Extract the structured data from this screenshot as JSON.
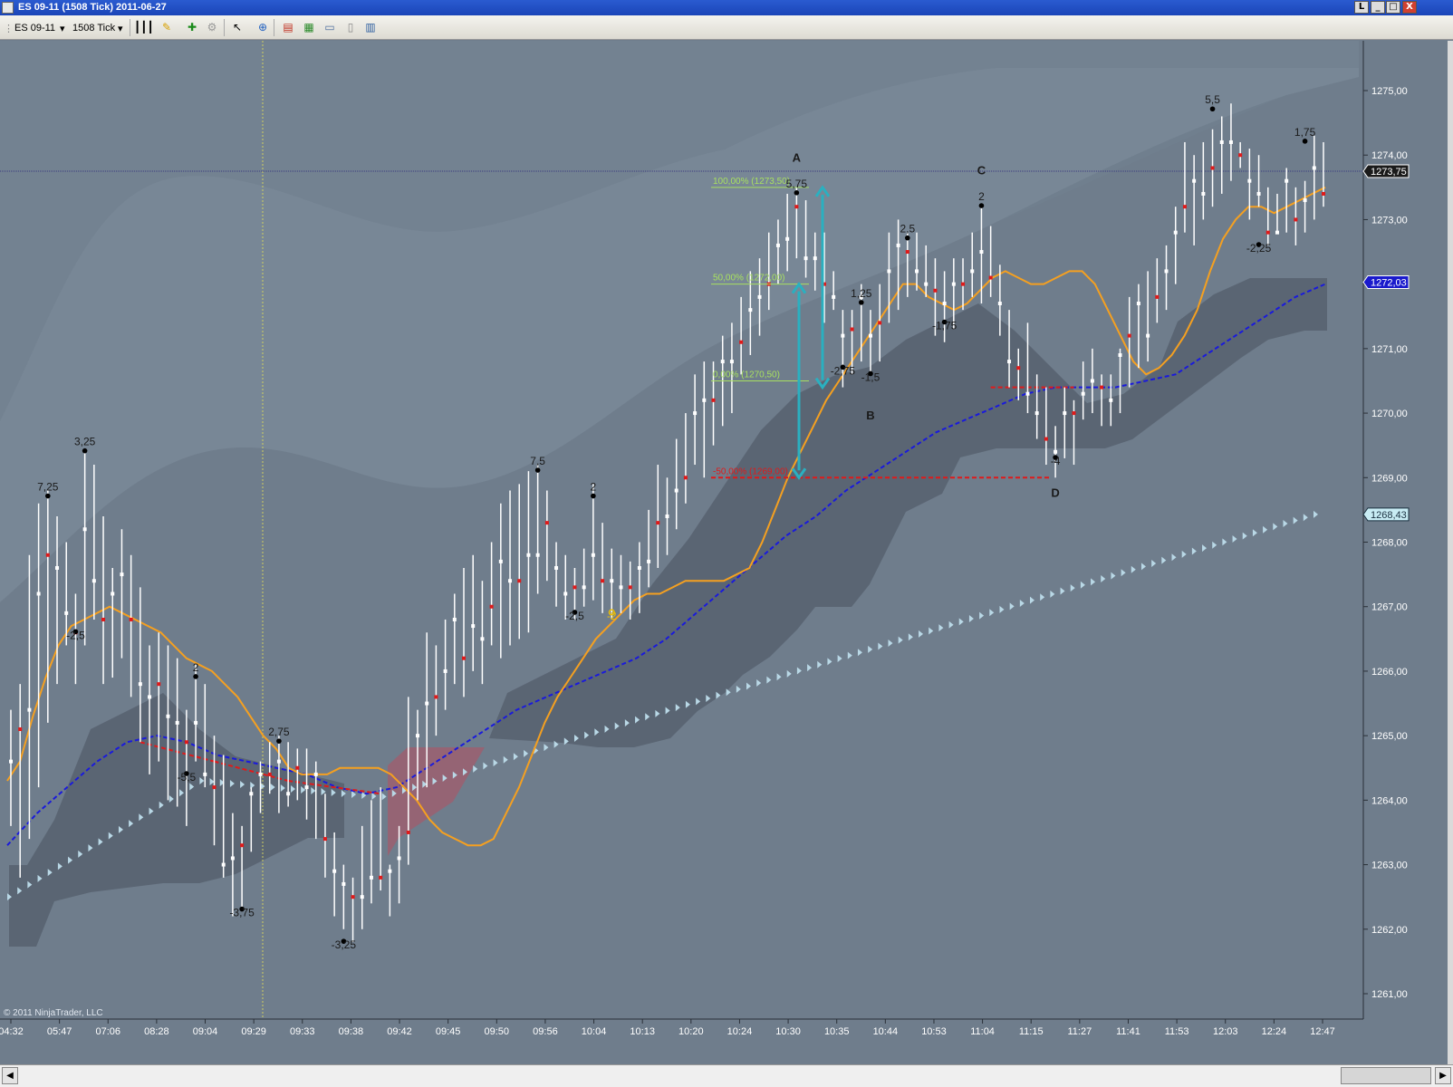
{
  "window": {
    "title": "ES 09-11 (1508 Tick)  2011-06-27",
    "buttons": [
      "L",
      "_",
      "□",
      "X"
    ]
  },
  "toolbar": {
    "instrument": "ES 09-11",
    "interval": "1508 Tick",
    "icons": [
      "bar-type-icon",
      "draw-pencil-icon",
      "add-indicator-icon",
      "strategy-icon",
      "cursor-icon",
      "zoom-icon",
      "chart-trader-icon",
      "data-box-icon",
      "chart-style-icon",
      "properties-icon",
      "window-icon"
    ]
  },
  "colors": {
    "background": "#6f7d8c",
    "orange_ma": "#f5a020",
    "blue_ma": "#1a1adc",
    "red_ma": "#e01a1a",
    "fib": "#a8e060",
    "arrows": "#2ab0c0",
    "triangles": "#b9d8e6",
    "band": "#5a6573",
    "bar": "#ffffff"
  },
  "chart_data": {
    "type": "bar",
    "title": "ES 09-11 (1508 Tick)  2011-06-27",
    "y_axis": {
      "ticks": [
        "1275,00",
        "1274,00",
        "1273,00",
        "1272,00",
        "1271,00",
        "1270,00",
        "1269,00",
        "1268,00",
        "1267,00",
        "1266,00",
        "1265,00",
        "1264,00",
        "1263,00",
        "1262,00",
        "1261,00"
      ],
      "range": [
        1260.6,
        1275.8
      ]
    },
    "x_axis": {
      "ticks": [
        "04:32",
        "05:47",
        "07:06",
        "08:28",
        "09:04",
        "09:29",
        "09:33",
        "09:38",
        "09:42",
        "09:45",
        "09:50",
        "09:56",
        "10:04",
        "10:13",
        "10:20",
        "10:24",
        "10:30",
        "10:35",
        "10:44",
        "10:53",
        "11:04",
        "11:15",
        "11:27",
        "11:41",
        "11:53",
        "12:03",
        "12:24",
        "12:47"
      ]
    },
    "price_labels": [
      {
        "text": "1273,75",
        "value": 1273.75,
        "style": "last"
      },
      {
        "text": "1272,03",
        "value": 1272.03,
        "style": "blue"
      },
      {
        "text": "1268,43",
        "value": 1268.43,
        "style": "cyan"
      }
    ],
    "swing_labels": [
      {
        "text": "7,25",
        "x_index": 4,
        "value": 1268.8,
        "pos": "above"
      },
      {
        "text": "3,25",
        "x_index": 8,
        "value": 1269.5,
        "pos": "above"
      },
      {
        "text": "-2,5",
        "x_index": 7,
        "value": 1266.5,
        "pos": "below"
      },
      {
        "text": "2",
        "x_index": 20,
        "value": 1266.0,
        "pos": "above"
      },
      {
        "text": "-5,5",
        "x_index": 19,
        "value": 1264.3,
        "pos": "below"
      },
      {
        "text": "-3,75",
        "x_index": 25,
        "value": 1262.2,
        "pos": "below"
      },
      {
        "text": "2,75",
        "x_index": 29,
        "value": 1265.0,
        "pos": "above"
      },
      {
        "text": "-3,25",
        "x_index": 36,
        "value": 1261.7,
        "pos": "below"
      },
      {
        "text": "7,5",
        "x_index": 57,
        "value": 1269.2,
        "pos": "above"
      },
      {
        "text": "2",
        "x_index": 63,
        "value": 1268.8,
        "pos": "above"
      },
      {
        "text": "-2,5",
        "x_index": 61,
        "value": 1266.8,
        "pos": "below"
      },
      {
        "text": "-2",
        "x_index": 65,
        "value": 1266.8,
        "pos": "below",
        "color": "#f0c000"
      },
      {
        "text": "A",
        "x_index": 85,
        "value": 1273.9,
        "pos": "above"
      },
      {
        "text": "5,75",
        "x_index": 85,
        "value": 1273.5,
        "pos": "above"
      },
      {
        "text": "-2,75",
        "x_index": 90,
        "value": 1270.6,
        "pos": "below"
      },
      {
        "text": "1,25",
        "x_index": 92,
        "value": 1271.8,
        "pos": "above"
      },
      {
        "text": "-1,5",
        "x_index": 93,
        "value": 1270.5,
        "pos": "below"
      },
      {
        "text": "B",
        "x_index": 93,
        "value": 1269.9,
        "pos": "below"
      },
      {
        "text": "2,5",
        "x_index": 97,
        "value": 1272.8,
        "pos": "above"
      },
      {
        "text": "-1,75",
        "x_index": 101,
        "value": 1271.3,
        "pos": "below"
      },
      {
        "text": "C",
        "x_index": 105,
        "value": 1273.7,
        "pos": "above"
      },
      {
        "text": "2",
        "x_index": 105,
        "value": 1273.3,
        "pos": "above"
      },
      {
        "text": "-4",
        "x_index": 113,
        "value": 1269.2,
        "pos": "below"
      },
      {
        "text": "D",
        "x_index": 113,
        "value": 1268.7,
        "pos": "below"
      },
      {
        "text": "5,5",
        "x_index": 130,
        "value": 1274.8,
        "pos": "above"
      },
      {
        "text": "-2,25",
        "x_index": 135,
        "value": 1272.5,
        "pos": "below"
      },
      {
        "text": "1,75",
        "x_index": 140,
        "value": 1274.3,
        "pos": "above"
      }
    ],
    "fib_levels": [
      {
        "text": "100,00% (1273,50)",
        "value": 1273.5,
        "color": "#a8e060"
      },
      {
        "text": "50,00% (1272,00)",
        "value": 1272.0,
        "color": "#a8e060"
      },
      {
        "text": "0,00% (1270,50)",
        "value": 1270.5,
        "color": "#a8e060"
      },
      {
        "text": "-50,00% (1269,00)",
        "value": 1269.0,
        "color": "#e01a1a"
      }
    ],
    "watermark": "© 2011 NinjaTrader, LLC",
    "bars": [
      [
        1263.6,
        1265.4,
        1264.6
      ],
      [
        1262.8,
        1265.8,
        1265.1
      ],
      [
        1263.4,
        1267.8,
        1265.4
      ],
      [
        1264.2,
        1268.6,
        1267.2
      ],
      [
        1265.2,
        1268.8,
        1267.8
      ],
      [
        1265.8,
        1268.4,
        1267.6
      ],
      [
        1266.4,
        1268.0,
        1266.9
      ],
      [
        1265.8,
        1267.2,
        1266.6
      ],
      [
        1266.4,
        1269.4,
        1268.2
      ],
      [
        1266.8,
        1269.2,
        1267.4
      ],
      [
        1265.8,
        1268.4,
        1266.8
      ],
      [
        1265.9,
        1267.6,
        1267.2
      ],
      [
        1266.2,
        1268.2,
        1267.5
      ],
      [
        1265.6,
        1267.8,
        1266.8
      ],
      [
        1264.9,
        1267.3,
        1265.8
      ],
      [
        1264.4,
        1266.4,
        1265.6
      ],
      [
        1264.6,
        1266.6,
        1265.8
      ],
      [
        1264.0,
        1266.4,
        1265.3
      ],
      [
        1263.9,
        1266.2,
        1265.2
      ],
      [
        1263.6,
        1265.4,
        1264.9
      ],
      [
        1264.6,
        1266.1,
        1265.2
      ],
      [
        1264.2,
        1265.8,
        1264.4
      ],
      [
        1263.3,
        1265.0,
        1264.2
      ],
      [
        1262.8,
        1264.7,
        1263.0
      ],
      [
        1262.2,
        1263.8,
        1263.1
      ],
      [
        1262.3,
        1263.6,
        1263.3
      ],
      [
        1263.2,
        1264.2,
        1264.1
      ],
      [
        1263.8,
        1264.6,
        1264.4
      ],
      [
        1264.1,
        1264.9,
        1264.4
      ],
      [
        1263.8,
        1265.0,
        1264.6
      ],
      [
        1263.9,
        1264.9,
        1264.1
      ],
      [
        1264.0,
        1264.8,
        1264.5
      ],
      [
        1263.7,
        1264.8,
        1264.2
      ],
      [
        1263.4,
        1264.6,
        1264.4
      ],
      [
        1262.8,
        1264.1,
        1263.4
      ],
      [
        1262.2,
        1263.5,
        1262.9
      ],
      [
        1262.0,
        1263.0,
        1262.7
      ],
      [
        1261.8,
        1262.8,
        1262.5
      ],
      [
        1262.0,
        1263.6,
        1262.5
      ],
      [
        1262.4,
        1264.0,
        1262.8
      ],
      [
        1262.6,
        1264.2,
        1262.8
      ],
      [
        1262.2,
        1263.0,
        1262.9
      ],
      [
        1262.4,
        1263.6,
        1263.1
      ],
      [
        1263.0,
        1265.6,
        1263.5
      ],
      [
        1264.0,
        1265.4,
        1265.0
      ],
      [
        1264.2,
        1266.6,
        1265.5
      ],
      [
        1265.0,
        1266.4,
        1265.6
      ],
      [
        1265.4,
        1266.8,
        1266.0
      ],
      [
        1265.8,
        1267.2,
        1266.8
      ],
      [
        1265.6,
        1267.6,
        1266.2
      ],
      [
        1266.0,
        1267.8,
        1266.7
      ],
      [
        1265.8,
        1267.4,
        1266.5
      ],
      [
        1266.4,
        1268.0,
        1267.0
      ],
      [
        1266.2,
        1268.6,
        1267.7
      ],
      [
        1266.4,
        1268.8,
        1267.4
      ],
      [
        1266.5,
        1268.9,
        1267.4
      ],
      [
        1266.6,
        1269.1,
        1267.8
      ],
      [
        1267.2,
        1269.2,
        1267.8
      ],
      [
        1267.4,
        1268.8,
        1268.3
      ],
      [
        1267.0,
        1268.0,
        1267.6
      ],
      [
        1266.8,
        1267.8,
        1267.2
      ],
      [
        1266.8,
        1267.6,
        1267.3
      ],
      [
        1267.0,
        1267.9,
        1267.3
      ],
      [
        1267.1,
        1268.9,
        1267.8
      ],
      [
        1266.9,
        1268.3,
        1267.4
      ],
      [
        1266.8,
        1267.9,
        1267.4
      ],
      [
        1266.9,
        1267.8,
        1267.3
      ],
      [
        1266.8,
        1267.7,
        1267.3
      ],
      [
        1266.9,
        1268.0,
        1267.6
      ],
      [
        1267.3,
        1268.5,
        1267.7
      ],
      [
        1267.6,
        1269.2,
        1268.3
      ],
      [
        1267.8,
        1269.0,
        1268.4
      ],
      [
        1268.2,
        1269.6,
        1268.8
      ],
      [
        1268.6,
        1270.0,
        1269.0
      ],
      [
        1269.2,
        1270.6,
        1270.0
      ],
      [
        1269.0,
        1270.8,
        1270.2
      ],
      [
        1269.5,
        1270.8,
        1270.2
      ],
      [
        1269.8,
        1271.2,
        1270.8
      ],
      [
        1270.0,
        1271.4,
        1270.8
      ],
      [
        1270.6,
        1271.8,
        1271.1
      ],
      [
        1270.9,
        1272.2,
        1271.6
      ],
      [
        1271.2,
        1272.4,
        1271.8
      ],
      [
        1271.6,
        1272.8,
        1272.0
      ],
      [
        1272.0,
        1273.0,
        1272.6
      ],
      [
        1272.2,
        1273.4,
        1272.7
      ],
      [
        1272.4,
        1273.5,
        1273.2
      ],
      [
        1272.1,
        1273.3,
        1272.4
      ],
      [
        1271.9,
        1272.8,
        1272.4
      ],
      [
        1271.4,
        1272.8,
        1272.0
      ],
      [
        1271.6,
        1272.2,
        1271.8
      ],
      [
        1270.4,
        1271.6,
        1271.2
      ],
      [
        1270.6,
        1271.6,
        1271.3
      ],
      [
        1270.8,
        1272.0,
        1271.8
      ],
      [
        1270.6,
        1271.6,
        1271.2
      ],
      [
        1270.8,
        1272.0,
        1271.4
      ],
      [
        1271.4,
        1272.8,
        1272.2
      ],
      [
        1271.6,
        1273.0,
        1272.6
      ],
      [
        1271.8,
        1272.8,
        1272.5
      ],
      [
        1271.9,
        1272.8,
        1272.2
      ],
      [
        1271.8,
        1272.6,
        1272.0
      ],
      [
        1271.2,
        1272.4,
        1271.9
      ],
      [
        1271.1,
        1272.2,
        1271.7
      ],
      [
        1271.3,
        1272.4,
        1272.0
      ],
      [
        1271.6,
        1272.4,
        1272.0
      ],
      [
        1271.8,
        1272.8,
        1272.2
      ],
      [
        1271.7,
        1273.2,
        1272.5
      ],
      [
        1271.8,
        1272.9,
        1272.1
      ],
      [
        1271.2,
        1272.3,
        1271.7
      ],
      [
        1270.4,
        1271.6,
        1270.8
      ],
      [
        1270.2,
        1271.0,
        1270.7
      ],
      [
        1270.0,
        1271.4,
        1270.3
      ],
      [
        1269.6,
        1270.6,
        1270.0
      ],
      [
        1269.2,
        1270.4,
        1269.6
      ],
      [
        1269.0,
        1269.8,
        1269.4
      ],
      [
        1269.3,
        1270.4,
        1270.0
      ],
      [
        1269.2,
        1270.2,
        1270.0
      ],
      [
        1269.9,
        1270.8,
        1270.3
      ],
      [
        1270.0,
        1271.0,
        1270.5
      ],
      [
        1269.8,
        1270.6,
        1270.4
      ],
      [
        1269.8,
        1270.6,
        1270.2
      ],
      [
        1270.0,
        1271.0,
        1270.9
      ],
      [
        1270.4,
        1271.8,
        1271.2
      ],
      [
        1270.7,
        1272.0,
        1271.7
      ],
      [
        1270.8,
        1272.2,
        1271.2
      ],
      [
        1271.4,
        1272.4,
        1271.8
      ],
      [
        1271.6,
        1272.6,
        1272.2
      ],
      [
        1272.0,
        1273.2,
        1272.8
      ],
      [
        1272.8,
        1274.2,
        1273.2
      ],
      [
        1272.6,
        1274.0,
        1273.6
      ],
      [
        1273.0,
        1274.2,
        1273.4
      ],
      [
        1273.2,
        1274.4,
        1273.8
      ],
      [
        1273.4,
        1274.6,
        1274.2
      ],
      [
        1273.6,
        1274.8,
        1274.2
      ],
      [
        1273.8,
        1274.2,
        1274.0
      ],
      [
        1273.0,
        1274.1,
        1273.6
      ],
      [
        1273.2,
        1274.0,
        1273.4
      ],
      [
        1272.6,
        1273.5,
        1272.8
      ],
      [
        1272.8,
        1273.4,
        1272.8
      ],
      [
        1272.8,
        1273.8,
        1273.6
      ],
      [
        1272.6,
        1273.5,
        1273.0
      ],
      [
        1272.8,
        1273.6,
        1273.3
      ],
      [
        1273.0,
        1274.3,
        1273.8
      ],
      [
        1273.2,
        1274.2,
        1273.4
      ]
    ],
    "orange_ma": [
      1264.3,
      1264.6,
      1265.3,
      1265.9,
      1266.4,
      1266.7,
      1266.8,
      1266.9,
      1267.0,
      1266.9,
      1266.8,
      1266.7,
      1266.6,
      1266.4,
      1266.2,
      1266.1,
      1266.0,
      1265.8,
      1265.6,
      1265.3,
      1265.0,
      1264.8,
      1264.5,
      1264.4,
      1264.4,
      1264.4,
      1264.5,
      1264.5,
      1264.5,
      1264.5,
      1264.4,
      1264.2,
      1264.0,
      1263.7,
      1263.5,
      1263.4,
      1263.3,
      1263.3,
      1263.4,
      1263.8,
      1264.2,
      1264.7,
      1265.2,
      1265.6,
      1265.9,
      1266.2,
      1266.5,
      1266.7,
      1266.9,
      1267.1,
      1267.2,
      1267.2,
      1267.3,
      1267.4,
      1267.4,
      1267.4,
      1267.4,
      1267.5,
      1267.6,
      1268.0,
      1268.5,
      1269.0,
      1269.4,
      1269.8,
      1270.2,
      1270.5,
      1270.8,
      1271.1,
      1271.4,
      1271.7,
      1272.0,
      1272.0,
      1271.8,
      1271.7,
      1271.6,
      1271.7,
      1271.9,
      1272.1,
      1272.2,
      1272.1,
      1272.0,
      1272.0,
      1272.1,
      1272.2,
      1272.2,
      1272.0,
      1271.6,
      1271.2,
      1270.8,
      1270.6,
      1270.7,
      1270.9,
      1271.2,
      1271.6,
      1272.2,
      1272.7,
      1273.0,
      1273.2,
      1273.2,
      1273.1,
      1273.2,
      1273.3,
      1273.4,
      1273.5
    ],
    "blue_ma": [
      1263.3,
      1263.8,
      1264.2,
      1264.6,
      1264.9,
      1265.0,
      1264.9,
      1264.7,
      1264.6,
      1264.5,
      1264.4,
      1264.2,
      1264.1,
      1264.2,
      1264.5,
      1264.8,
      1265.1,
      1265.4,
      1265.6,
      1265.8,
      1266.0,
      1266.2,
      1266.5,
      1266.9,
      1267.3,
      1267.7,
      1268.1,
      1268.4,
      1268.8,
      1269.1,
      1269.4,
      1269.7,
      1269.9,
      1270.1,
      1270.3,
      1270.4,
      1270.4,
      1270.4,
      1270.5,
      1270.6,
      1270.9,
      1271.2,
      1271.5,
      1271.8,
      1272.0
    ],
    "red_ma": [
      [
        14,
        1264.9
      ],
      [
        22,
        1264.6
      ],
      [
        30,
        1264.3
      ],
      [
        40,
        1264.1
      ],
      [
        106,
        1270.4
      ],
      [
        115,
        1270.4
      ]
    ],
    "triangles_start": 1262.5,
    "triangles_end": 1268.43
  }
}
